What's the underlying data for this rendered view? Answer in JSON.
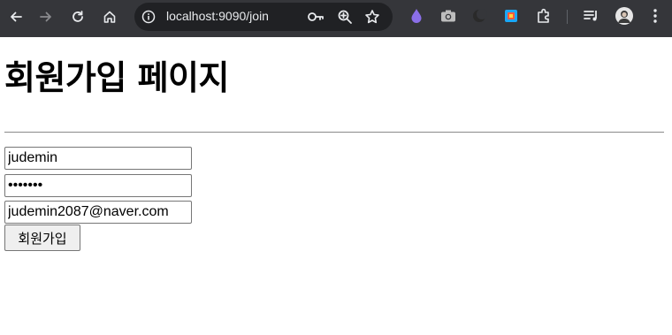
{
  "browser": {
    "url": "localhost:9090/join",
    "accent": "#35363a"
  },
  "page": {
    "title": "회원가입 페이지",
    "form": {
      "username_value": "judemin",
      "password_value": "1234567",
      "email_value": "judemin2087@naver.com",
      "submit_label": "회원가입"
    }
  }
}
